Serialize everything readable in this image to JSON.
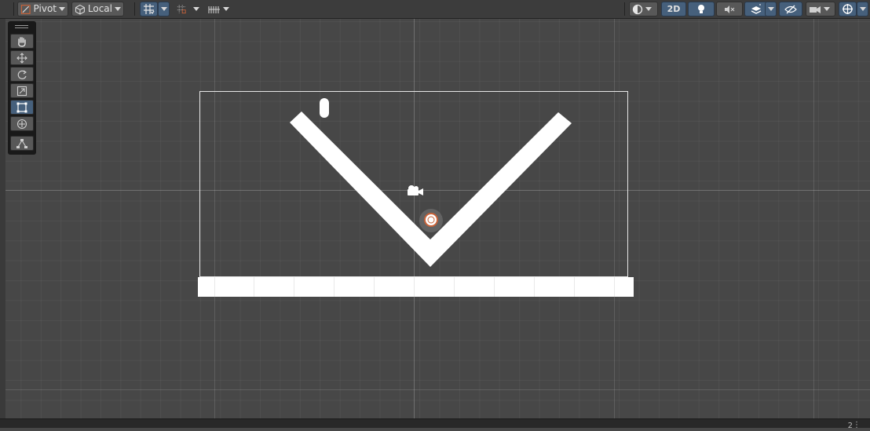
{
  "toolbar": {
    "pivot_label": "Pivot",
    "local_label": "Local",
    "mode_2d_label": "2D"
  },
  "icons": {
    "pivot": "pivot-icon",
    "local": "cube-icon",
    "grid_snap": "grid-snap-icon",
    "increment_snap": "increment-snap-icon",
    "ruler": "ruler-icon",
    "draw_mode": "shading-mode-icon",
    "lighting": "lightbulb-icon",
    "audio": "audio-mute-icon",
    "effects": "effects-icon",
    "visibility": "visibility-icon",
    "camera": "camera-icon",
    "gizmos": "gizmos-icon"
  },
  "tools": [
    {
      "name": "hand-tool",
      "icon": "hand-icon"
    },
    {
      "name": "move-tool",
      "icon": "move-icon"
    },
    {
      "name": "rotate-tool",
      "icon": "rotate-icon"
    },
    {
      "name": "scale-tool",
      "icon": "scale-icon"
    },
    {
      "name": "rect-tool",
      "icon": "rect-icon",
      "active": true
    },
    {
      "name": "transform-tool",
      "icon": "transform-icon"
    },
    {
      "name": "custom-tool",
      "icon": "custom-tool-icon"
    }
  ],
  "colors": {
    "scene_bg": "#474747",
    "toolbar_bg": "#3c3c3c",
    "active_button": "#46607c",
    "sprite_white": "#ffffff",
    "ball_outline": "#c8633a"
  },
  "status": {
    "count": "2"
  }
}
